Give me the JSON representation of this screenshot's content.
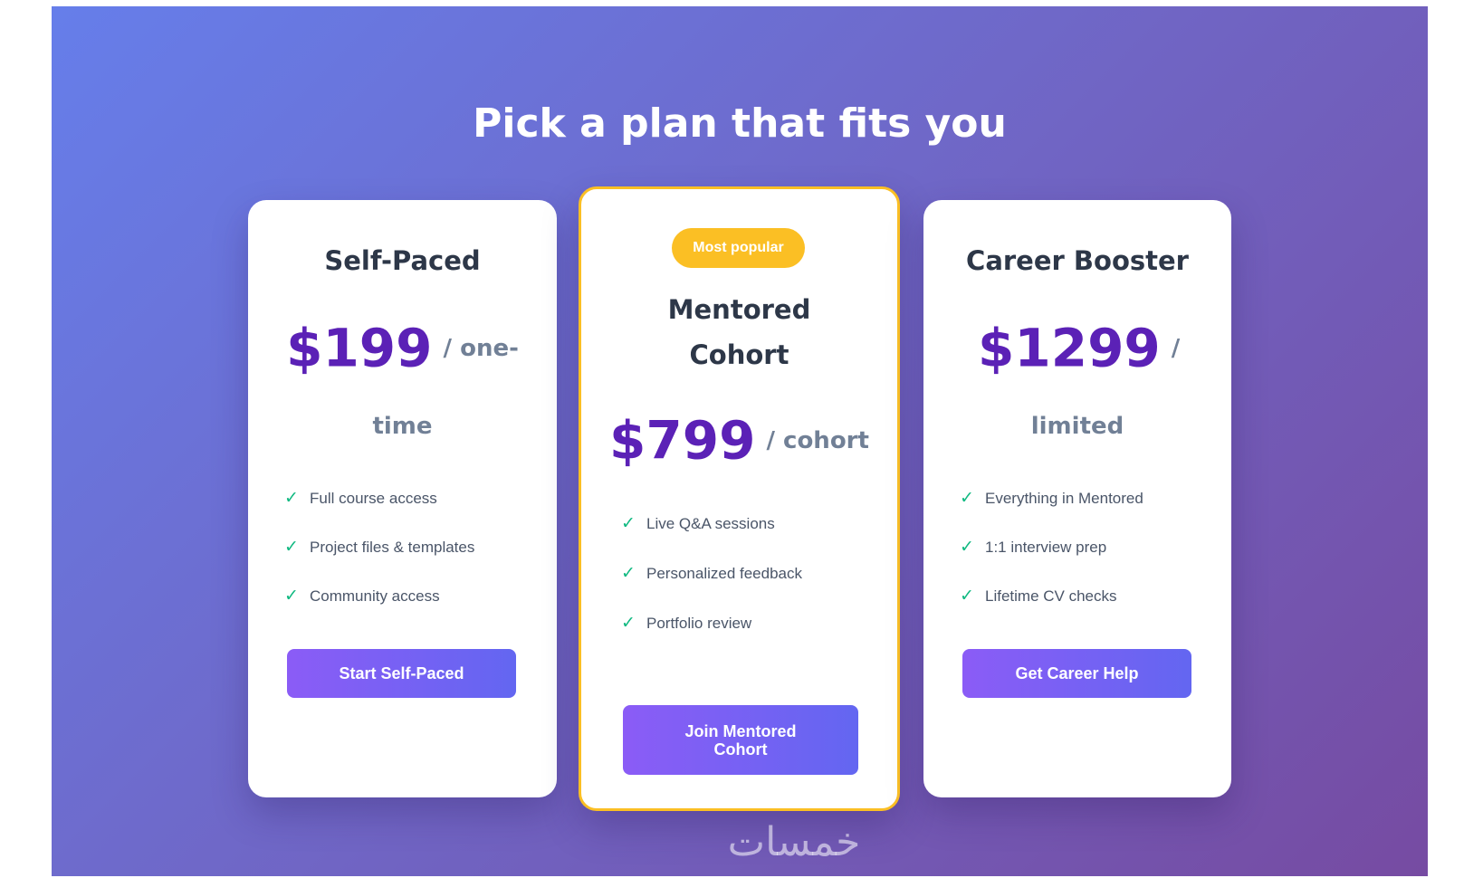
{
  "heading": "Pick a plan that fits you",
  "colors": {
    "gradient_start": "#667eea",
    "gradient_end": "#764ba2",
    "price": "#5b21b6",
    "badge": "#fbbf24",
    "check": "#10b981",
    "button_start": "#8b5cf6",
    "button_end": "#6366f1"
  },
  "plans": [
    {
      "name": "Self-Paced",
      "price": "$199",
      "period": "/ one-time",
      "features": [
        "Full course access",
        "Project files & templates",
        "Community access"
      ],
      "cta": "Start Self-Paced"
    },
    {
      "badge": "Most popular",
      "name": "Mentored Cohort",
      "price": "$799",
      "period": "/ cohort",
      "features": [
        "Live Q&A sessions",
        "Personalized feedback",
        "Portfolio review"
      ],
      "cta": "Join Mentored Cohort",
      "highlighted": true
    },
    {
      "name": "Career Booster",
      "price": "$1299",
      "period": "/ limited",
      "features": [
        "Everything in Mentored",
        "1:1 interview prep",
        "Lifetime CV checks"
      ],
      "cta": "Get Career Help"
    }
  ],
  "check_icon": "✓",
  "watermark": "خمسات"
}
